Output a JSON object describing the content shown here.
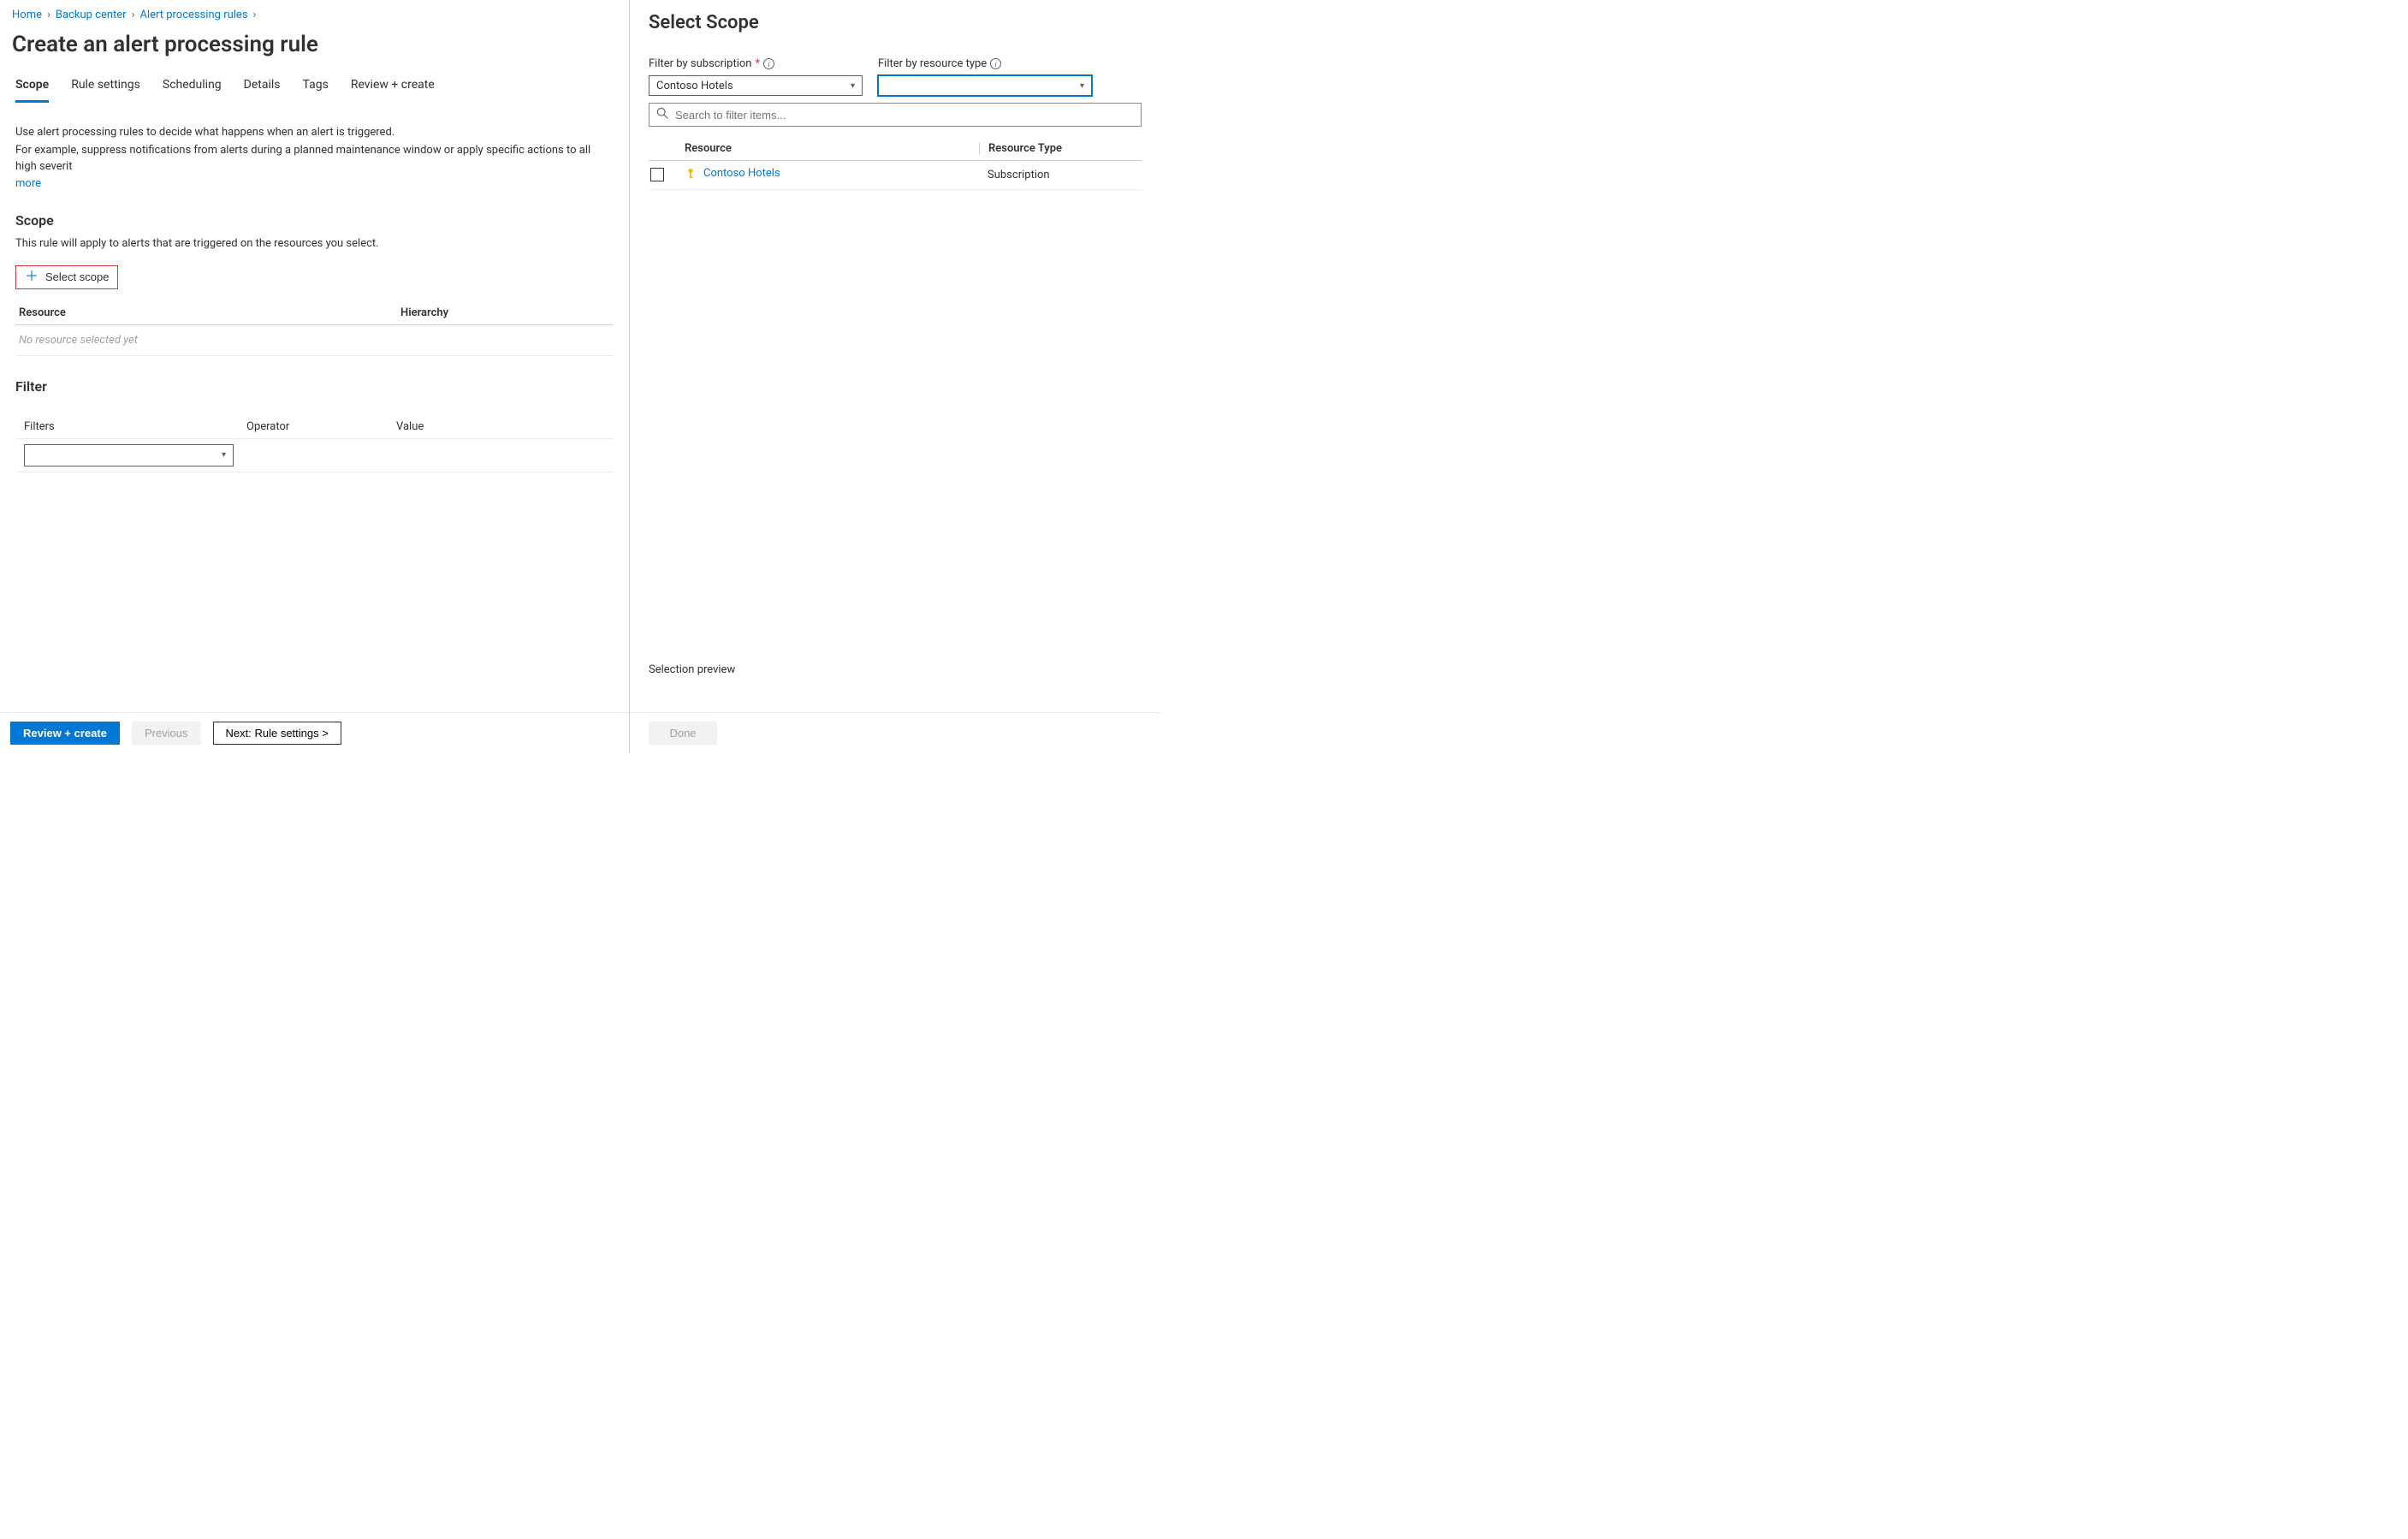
{
  "breadcrumb": {
    "home": "Home",
    "backup_center": "Backup center",
    "alert_rules": "Alert processing rules"
  },
  "page_title": "Create an alert processing rule",
  "tabs": {
    "scope": "Scope",
    "rule_settings": "Rule settings",
    "scheduling": "Scheduling",
    "details": "Details",
    "tags": "Tags",
    "review": "Review + create"
  },
  "intro": {
    "line1": "Use alert processing rules to decide what happens when an alert is triggered.",
    "line2": "For example, suppress notifications from alerts during a planned maintenance window or apply specific actions to all high severit",
    "learn_more": "more"
  },
  "scope": {
    "heading": "Scope",
    "desc": "This rule will apply to alerts that are triggered on the resources you select.",
    "select_btn": "Select scope",
    "col_resource": "Resource",
    "col_hierarchy": "Hierarchy",
    "empty": "No resource selected yet"
  },
  "filter": {
    "heading": "Filter",
    "col_filters": "Filters",
    "col_operator": "Operator",
    "col_value": "Value"
  },
  "footer": {
    "review": "Review + create",
    "previous": "Previous",
    "next": "Next: Rule settings >"
  },
  "right": {
    "title": "Select Scope",
    "filter_sub_label": "Filter by subscription",
    "filter_type_label": "Filter by resource type",
    "sub_value": "Contoso Hotels",
    "type_value": "",
    "search_placeholder": "Search to filter items...",
    "col_resource": "Resource",
    "col_type": "Resource Type",
    "row_resource": "Contoso Hotels",
    "row_type": "Subscription",
    "selection_preview": "Selection preview",
    "done": "Done"
  }
}
